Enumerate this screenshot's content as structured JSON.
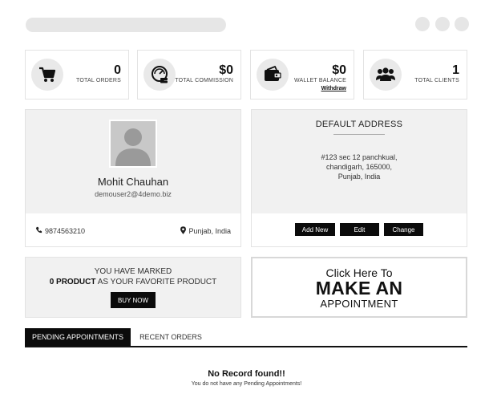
{
  "stats": [
    {
      "value": "0",
      "label": "TOTAL ORDERS",
      "icon": "cart-icon"
    },
    {
      "value": "$0",
      "label": "TOTAL COMMISSION",
      "icon": "commission-icon"
    },
    {
      "value": "$0",
      "label": "WALLET BALANCE",
      "sub_link": "Withdraw",
      "icon": "wallet-icon"
    },
    {
      "value": "1",
      "label": "TOTAL CLIENTS",
      "icon": "users-icon"
    }
  ],
  "profile": {
    "name": "Mohit Chauhan",
    "email": "demouser2@4demo.biz",
    "phone": "9874563210",
    "location": "Punjab, India"
  },
  "address": {
    "title": "DEFAULT ADDRESS",
    "lines": [
      "#123 sec 12 panchkual,",
      "chandigarh, 165000,",
      "Punjab, India"
    ],
    "buttons": {
      "add": "Add New",
      "edit": "Edit",
      "change": "Change"
    }
  },
  "favorites": {
    "line1": "YOU HAVE MARKED",
    "count": "0 PRODUCT",
    "line2_rest": " AS YOUR FAVORITE PRODUCT",
    "button": "BUY NOW"
  },
  "appointment": {
    "line1": "Click Here To",
    "line2": "MAKE AN",
    "line3": "APPOINTMENT"
  },
  "tabs": [
    {
      "label": "PENDING APPOINTMENTS",
      "active": true
    },
    {
      "label": "RECENT ORDERS",
      "active": false
    }
  ],
  "empty_state": {
    "title": "No Record found!!",
    "subtitle": "You do not have any Pending Appointments!"
  }
}
